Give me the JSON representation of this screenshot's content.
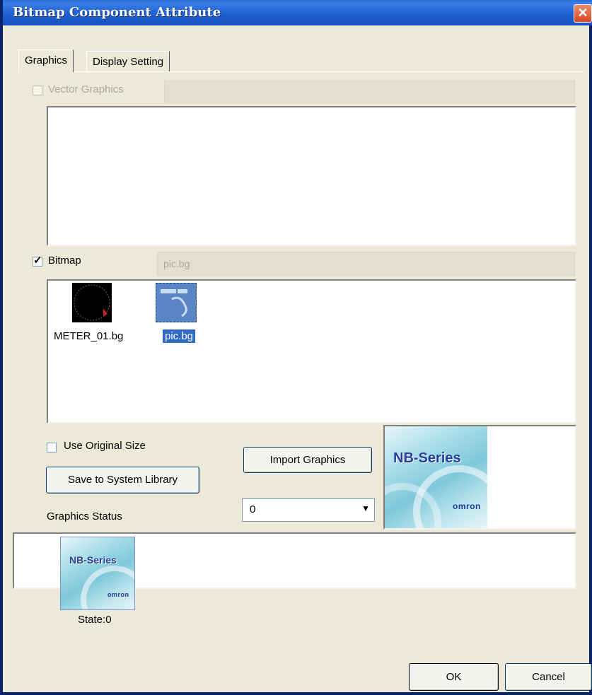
{
  "window": {
    "title": "Bitmap Component Attribute",
    "close_glyph": "✕"
  },
  "tabs": [
    {
      "label": "Graphics",
      "active": true
    },
    {
      "label": "Display Setting",
      "active": false
    }
  ],
  "vector": {
    "label": "Vector Graphics",
    "checked": false,
    "enabled": false,
    "field_value": ""
  },
  "bitmap": {
    "label": "Bitmap",
    "checked": true,
    "field_value": "pic.bg",
    "files": [
      {
        "name": "METER_01.bg",
        "selected": false
      },
      {
        "name": "pic.bg",
        "selected": true
      }
    ]
  },
  "options": {
    "use_original_size_label": "Use Original Size",
    "use_original_size_checked": false,
    "save_library_label": "Save to System Library",
    "import_label": "Import Graphics",
    "state_select_value": "0",
    "graphics_status_label": "Graphics Status"
  },
  "preview": {
    "brand_text": "NB-Series",
    "logo_text": "omron"
  },
  "status_items": [
    {
      "label": "State:0",
      "brand_text": "NB-Series",
      "logo_text": "omron"
    }
  ],
  "footer": {
    "ok_label": "OK",
    "cancel_label": "Cancel"
  },
  "colors": {
    "title_bar": "#2563d8",
    "selection": "#316ac5",
    "face": "#ece9d8"
  }
}
